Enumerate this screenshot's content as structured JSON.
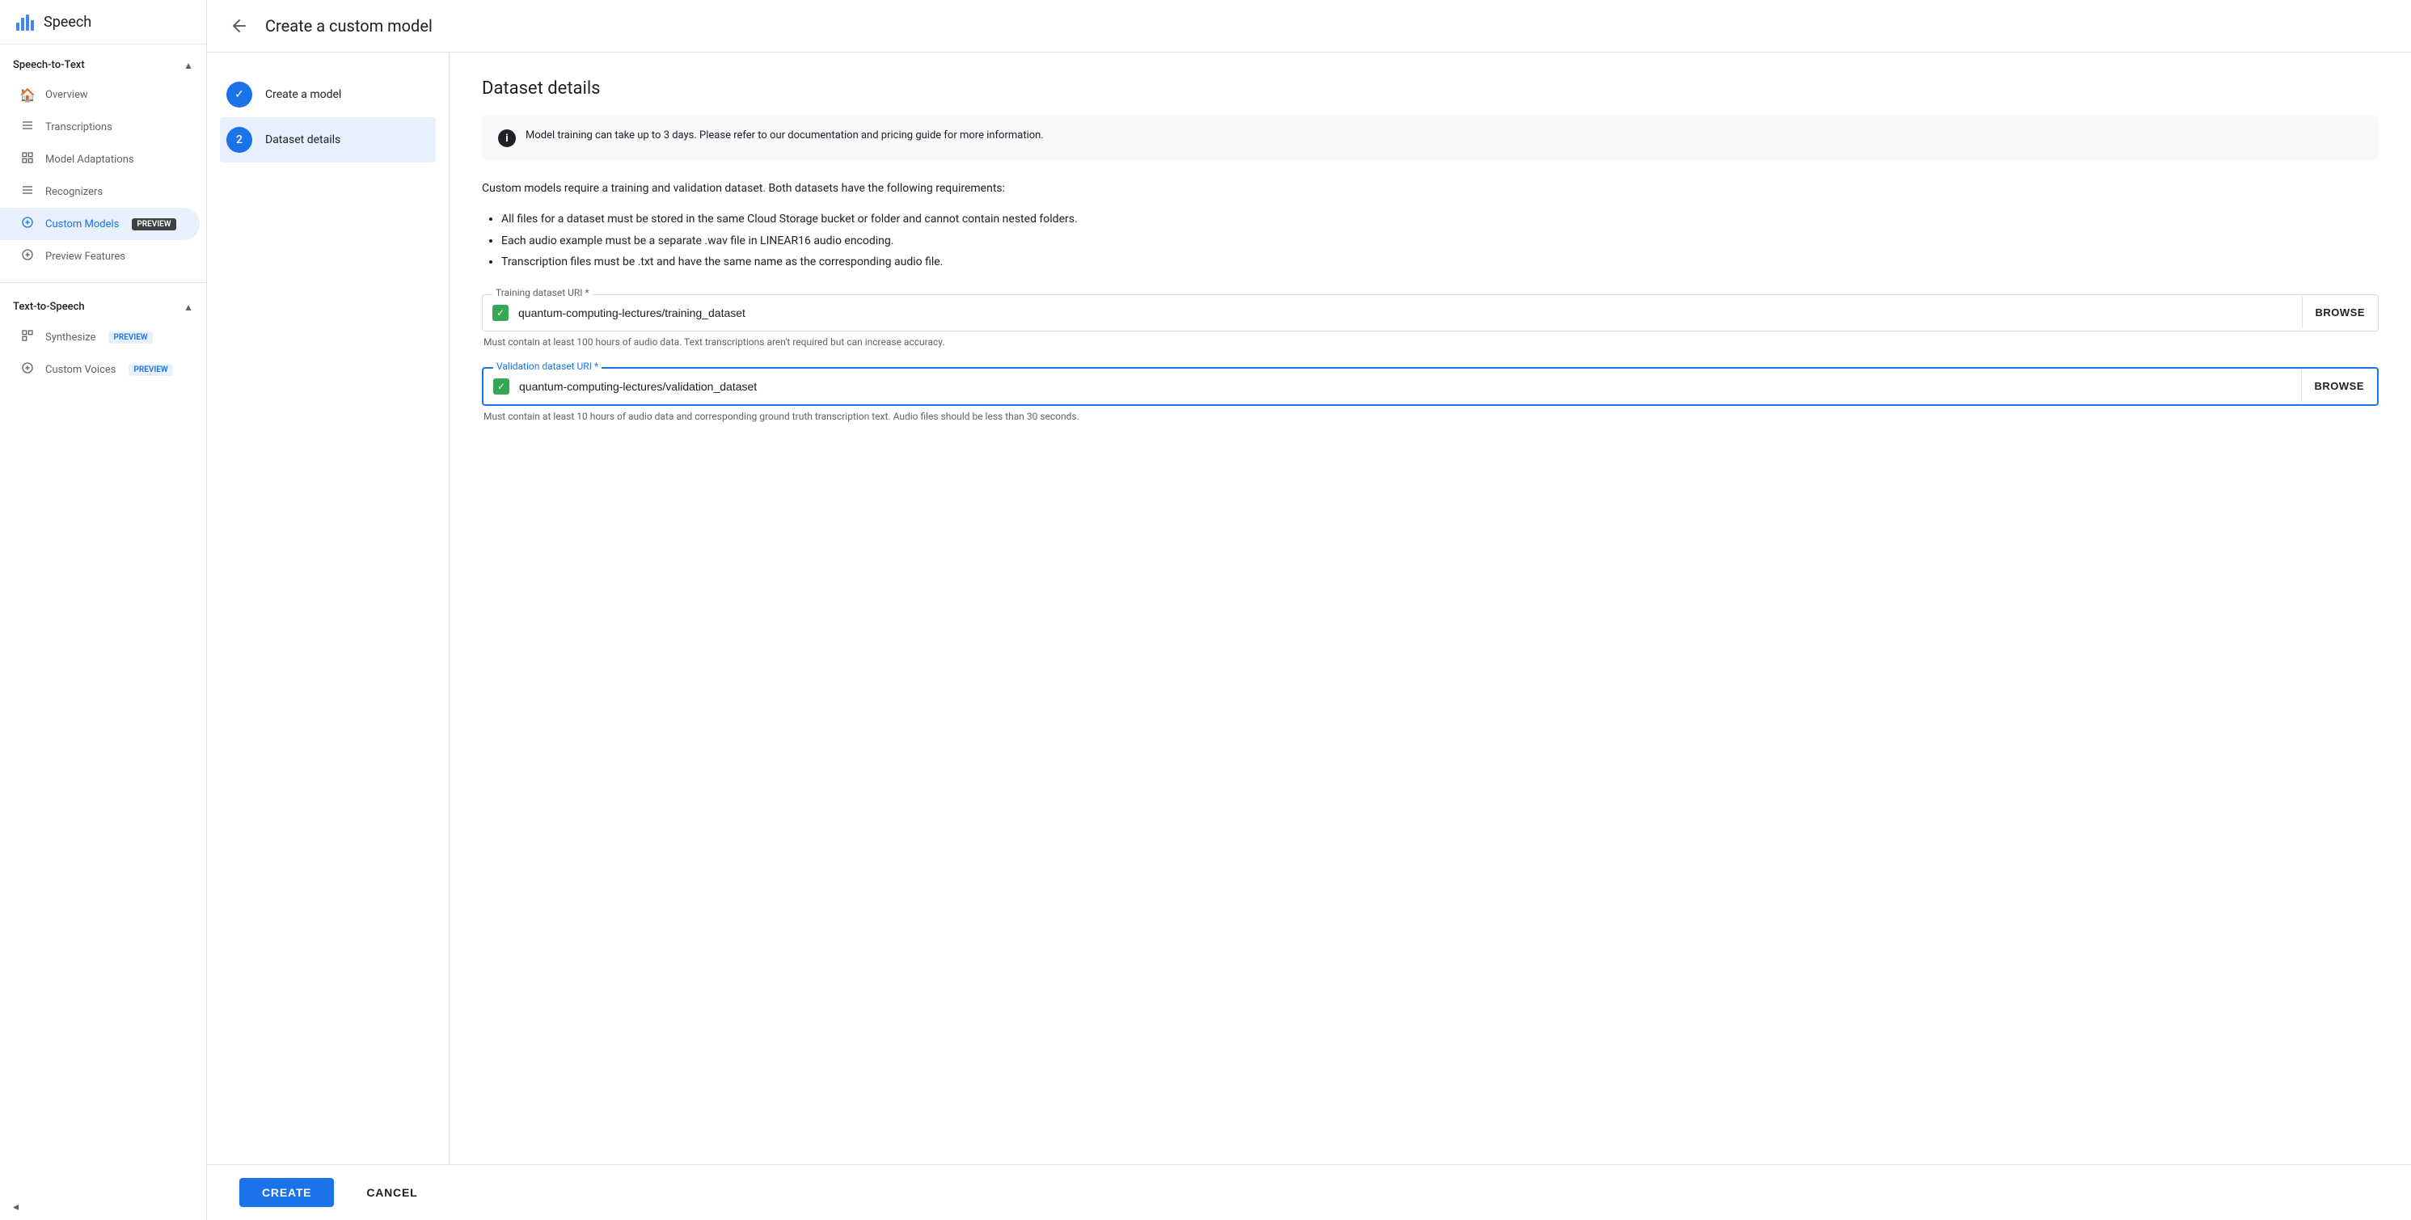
{
  "app": {
    "title": "Speech",
    "back_label": "←"
  },
  "topbar": {
    "title": "Create a custom model"
  },
  "sidebar": {
    "speech_to_text_label": "Speech-to-Text",
    "text_to_speech_label": "Text-to-Speech",
    "items_stt": [
      {
        "id": "overview",
        "label": "Overview",
        "icon": "🏠"
      },
      {
        "id": "transcriptions",
        "label": "Transcriptions",
        "icon": "☰"
      },
      {
        "id": "model-adaptations",
        "label": "Model Adaptations",
        "icon": "📊"
      },
      {
        "id": "recognizers",
        "label": "Recognizers",
        "icon": "☰"
      },
      {
        "id": "custom-models",
        "label": "Custom Models",
        "icon": "⊕",
        "badge": "PREVIEW",
        "active": true
      },
      {
        "id": "preview-features",
        "label": "Preview Features",
        "icon": "⊕"
      }
    ],
    "items_tts": [
      {
        "id": "synthesize",
        "label": "Synthesize",
        "icon": "📊",
        "badge": "PREVIEW"
      },
      {
        "id": "custom-voices",
        "label": "Custom Voices",
        "icon": "⊕",
        "badge": "PREVIEW",
        "active": false
      }
    ],
    "collapse_label": "◂"
  },
  "steps": [
    {
      "id": "create-model",
      "label": "Create a model",
      "state": "completed",
      "number": "✓"
    },
    {
      "id": "dataset-details",
      "label": "Dataset details",
      "state": "active",
      "number": "2"
    }
  ],
  "dataset": {
    "title": "Dataset details",
    "info_text": "Model training can take up to 3 days. Please refer to our documentation and pricing guide for more information.",
    "description": "Custom models require a training and validation dataset. Both datasets have the following requirements:",
    "requirements": [
      "All files for a dataset must be stored in the same Cloud Storage bucket or folder and cannot contain nested folders.",
      "Each audio example must be a separate .wav file in LINEAR16 audio encoding.",
      "Transcription files must be .txt and have the same name as the corresponding audio file."
    ],
    "training_uri_label": "Training dataset URI *",
    "training_uri_value": "quantum-computing-lectures/training_dataset",
    "training_hint": "Must contain at least 100 hours of audio data. Text transcriptions aren't required but can increase accuracy.",
    "browse_label": "BROWSE",
    "validation_uri_label": "Validation dataset URI *",
    "validation_uri_value": "quantum-computing-lectures/validation_dataset",
    "validation_hint": "Must contain at least 10 hours of audio data and corresponding ground truth transcription text. Audio files should be less than 30 seconds."
  },
  "actions": {
    "create_label": "CREATE",
    "cancel_label": "CANCEL"
  }
}
